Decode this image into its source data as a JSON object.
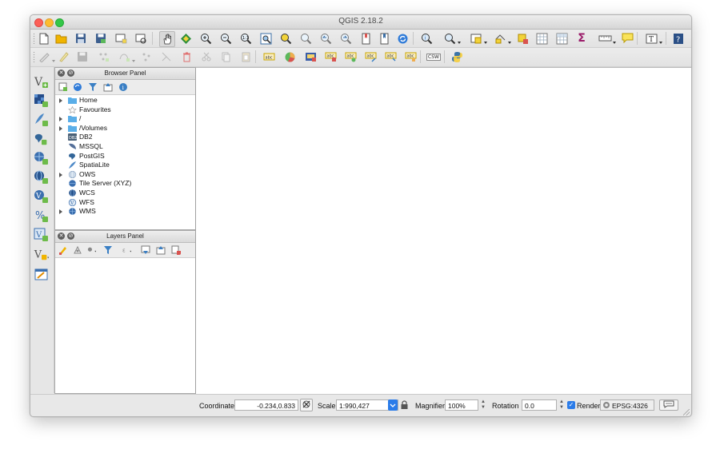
{
  "window": {
    "title": "QGIS 2.18.2"
  },
  "toolbar_main": {
    "icons": [
      "new-project-icon",
      "open-project-icon",
      "save-project-icon",
      "save-as-icon",
      "new-print-composer-icon",
      "composer-manager-icon",
      "pan-hand-icon",
      "pan-to-selection-icon",
      "zoom-in-icon",
      "zoom-out-icon",
      "zoom-1-1-icon",
      "zoom-full-icon",
      "zoom-selection-icon",
      "zoom-layer-icon",
      "zoom-last-icon",
      "zoom-next-icon",
      "new-bookmark-icon",
      "show-bookmarks-icon",
      "refresh-icon",
      "identify-icon",
      "select-features-icon",
      "select-by-expression-icon",
      "deselect-icon",
      "attribute-table-icon",
      "field-calculator-icon",
      "statistics-sum-icon",
      "measure-icon",
      "annotation-icon",
      "text-annotation-icon",
      "help-icon"
    ],
    "statistics_symbol": "Σ"
  },
  "toolbar_edit": {
    "icons": [
      "current-edits-icon",
      "toggle-editing-icon",
      "save-layer-edits-icon",
      "add-feature-icon",
      "node-tool-icon",
      "move-feature-icon",
      "delete-selected-icon",
      "cut-features-icon",
      "copy-features-icon",
      "paste-features-icon",
      "label-toolbar-icon",
      "diagram-icon",
      "pin-labels-icon",
      "show-hide-labels-icon",
      "move-label-icon",
      "rotate-label-icon",
      "change-label-icon",
      "csw-icon",
      "python-console-icon"
    ],
    "csw_text": "CSW"
  },
  "left_toolbar": {
    "icons": [
      "add-vector-layer-icon",
      "add-raster-layer-icon",
      "add-spatialite-icon",
      "add-postgis-icon",
      "add-wms-icon",
      "add-wcs-icon",
      "add-wfs-icon",
      "add-delimited-text-icon",
      "add-virtual-layer-icon",
      "new-shapefile-icon",
      "add-oracle-icon"
    ]
  },
  "browser_panel": {
    "title": "Browser Panel",
    "items": [
      {
        "label": "Home",
        "icon": "folder-icon",
        "expandable": true
      },
      {
        "label": "Favourites",
        "icon": "star-icon",
        "expandable": false
      },
      {
        "label": "/",
        "icon": "folder-icon",
        "expandable": true
      },
      {
        "label": "/Volumes",
        "icon": "folder-icon",
        "expandable": true
      },
      {
        "label": "DB2",
        "icon": "db2-icon",
        "expandable": false
      },
      {
        "label": "MSSQL",
        "icon": "mssql-icon",
        "expandable": false
      },
      {
        "label": "PostGIS",
        "icon": "postgis-icon",
        "expandable": false
      },
      {
        "label": "SpatiaLite",
        "icon": "spatialite-icon",
        "expandable": false
      },
      {
        "label": "OWS",
        "icon": "globe-icon",
        "expandable": true
      },
      {
        "label": "Tile Server (XYZ)",
        "icon": "globe-icon",
        "expandable": false
      },
      {
        "label": "WCS",
        "icon": "globe-icon",
        "expandable": false
      },
      {
        "label": "WFS",
        "icon": "globe-icon",
        "expandable": false
      },
      {
        "label": "WMS",
        "icon": "globe-icon",
        "expandable": true
      }
    ]
  },
  "layers_panel": {
    "title": "Layers Panel"
  },
  "statusbar": {
    "coordinate_label": "Coordinate",
    "coordinate_value": "-0.234,0.833",
    "scale_label": "Scale",
    "scale_value": "1:990,427",
    "magnifier_label": "Magnifier",
    "magnifier_value": "100%",
    "rotation_label": "Rotation",
    "rotation_value": "0.0",
    "render_label": "Render",
    "render_checked": true,
    "crs_value": "EPSG:4326"
  },
  "colors": {
    "accent_blue": "#2b7ce9",
    "folder_blue": "#5aaee8",
    "window_bg": "#e8e8e8"
  }
}
